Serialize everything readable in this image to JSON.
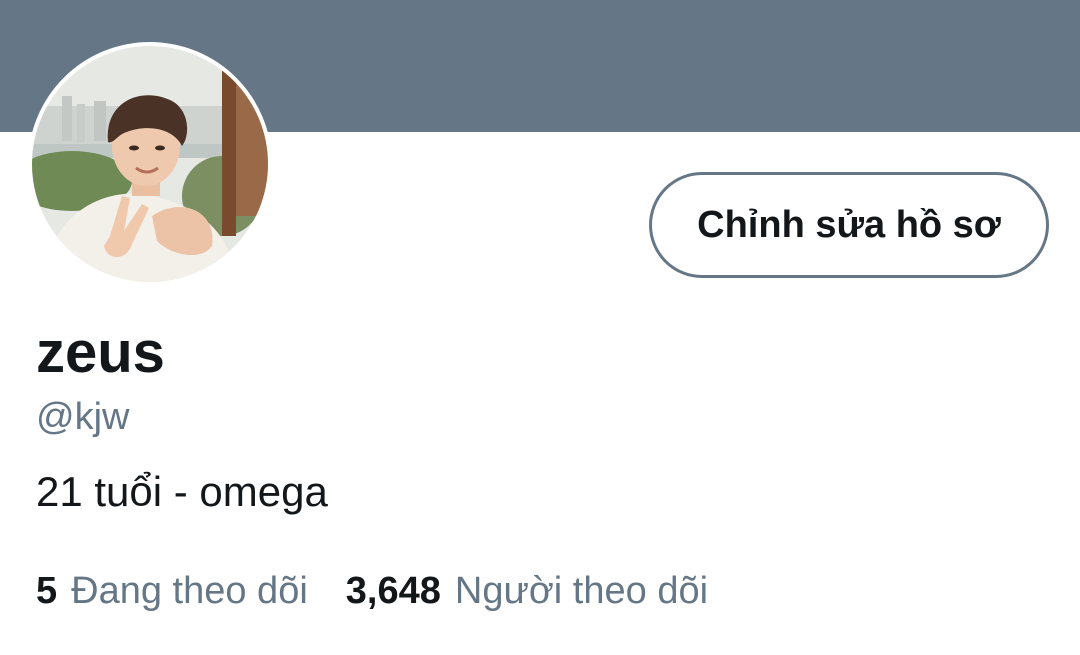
{
  "colors": {
    "banner": "#657786",
    "text_primary": "#14171a",
    "text_secondary": "#657786",
    "button_border": "#657786"
  },
  "profile": {
    "avatar_icon": "profile-photo",
    "edit_button_label": "Chỉnh sửa hồ sơ",
    "display_name": "zeus",
    "handle": "@kjw",
    "bio": "21 tuổi - omega"
  },
  "stats": {
    "following_count": "5",
    "following_label": "Đang theo dõi",
    "followers_count": "3,648",
    "followers_label": "Người theo dõi"
  }
}
